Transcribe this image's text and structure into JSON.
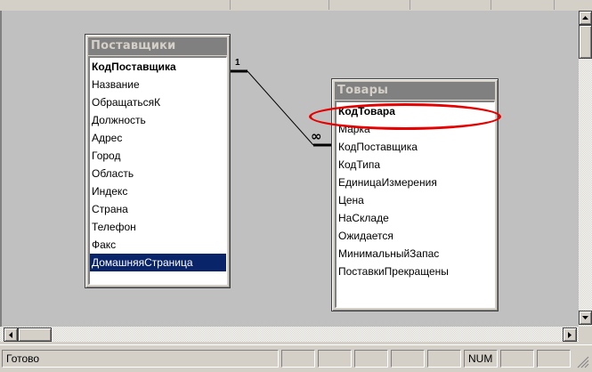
{
  "tables": [
    {
      "title": "Поставщики",
      "fields": [
        "КодПоставщика",
        "Название",
        "ОбращатьсяК",
        "Должность",
        "Адрес",
        "Город",
        "Область",
        "Индекс",
        "Страна",
        "Телефон",
        "Факс",
        "ДомашняяСтраница"
      ],
      "key_field": "КодПоставщика",
      "selected_field": "ДомашняяСтраница"
    },
    {
      "title": "Товары",
      "fields": [
        "КодТовара",
        "Марка",
        "КодПоставщика",
        "КодТипа",
        "ЕдиницаИзмерения",
        "Цена",
        "НаСкладе",
        "Ожидается",
        "МинимальныйЗапас",
        "ПоставкиПрекращены"
      ],
      "key_field": "КодТовара"
    }
  ],
  "relationship": {
    "one_label": "1",
    "many_label": "∞"
  },
  "highlight": {
    "field": "КодТовара",
    "color": "#e60000"
  },
  "statusbar": {
    "text": "Готово",
    "num": "NUM"
  },
  "icons": [
    "scroll-up-arrow-icon",
    "scroll-down-arrow-icon",
    "scroll-left-arrow-icon",
    "scroll-right-arrow-icon",
    "resize-grip-icon"
  ]
}
